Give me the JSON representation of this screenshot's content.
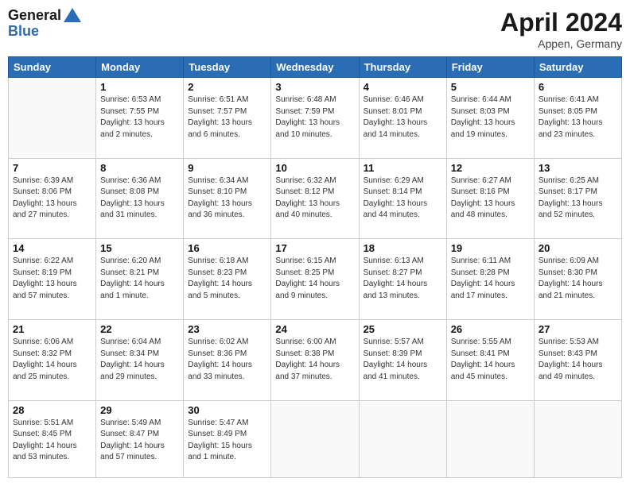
{
  "logo": {
    "line1": "General",
    "line2": "Blue"
  },
  "header": {
    "title": "April 2024",
    "subtitle": "Appen, Germany"
  },
  "days_of_week": [
    "Sunday",
    "Monday",
    "Tuesday",
    "Wednesday",
    "Thursday",
    "Friday",
    "Saturday"
  ],
  "weeks": [
    [
      {
        "day": "",
        "info": ""
      },
      {
        "day": "1",
        "info": "Sunrise: 6:53 AM\nSunset: 7:55 PM\nDaylight: 13 hours\nand 2 minutes."
      },
      {
        "day": "2",
        "info": "Sunrise: 6:51 AM\nSunset: 7:57 PM\nDaylight: 13 hours\nand 6 minutes."
      },
      {
        "day": "3",
        "info": "Sunrise: 6:48 AM\nSunset: 7:59 PM\nDaylight: 13 hours\nand 10 minutes."
      },
      {
        "day": "4",
        "info": "Sunrise: 6:46 AM\nSunset: 8:01 PM\nDaylight: 13 hours\nand 14 minutes."
      },
      {
        "day": "5",
        "info": "Sunrise: 6:44 AM\nSunset: 8:03 PM\nDaylight: 13 hours\nand 19 minutes."
      },
      {
        "day": "6",
        "info": "Sunrise: 6:41 AM\nSunset: 8:05 PM\nDaylight: 13 hours\nand 23 minutes."
      }
    ],
    [
      {
        "day": "7",
        "info": "Sunrise: 6:39 AM\nSunset: 8:06 PM\nDaylight: 13 hours\nand 27 minutes."
      },
      {
        "day": "8",
        "info": "Sunrise: 6:36 AM\nSunset: 8:08 PM\nDaylight: 13 hours\nand 31 minutes."
      },
      {
        "day": "9",
        "info": "Sunrise: 6:34 AM\nSunset: 8:10 PM\nDaylight: 13 hours\nand 36 minutes."
      },
      {
        "day": "10",
        "info": "Sunrise: 6:32 AM\nSunset: 8:12 PM\nDaylight: 13 hours\nand 40 minutes."
      },
      {
        "day": "11",
        "info": "Sunrise: 6:29 AM\nSunset: 8:14 PM\nDaylight: 13 hours\nand 44 minutes."
      },
      {
        "day": "12",
        "info": "Sunrise: 6:27 AM\nSunset: 8:16 PM\nDaylight: 13 hours\nand 48 minutes."
      },
      {
        "day": "13",
        "info": "Sunrise: 6:25 AM\nSunset: 8:17 PM\nDaylight: 13 hours\nand 52 minutes."
      }
    ],
    [
      {
        "day": "14",
        "info": "Sunrise: 6:22 AM\nSunset: 8:19 PM\nDaylight: 13 hours\nand 57 minutes."
      },
      {
        "day": "15",
        "info": "Sunrise: 6:20 AM\nSunset: 8:21 PM\nDaylight: 14 hours\nand 1 minute."
      },
      {
        "day": "16",
        "info": "Sunrise: 6:18 AM\nSunset: 8:23 PM\nDaylight: 14 hours\nand 5 minutes."
      },
      {
        "day": "17",
        "info": "Sunrise: 6:15 AM\nSunset: 8:25 PM\nDaylight: 14 hours\nand 9 minutes."
      },
      {
        "day": "18",
        "info": "Sunrise: 6:13 AM\nSunset: 8:27 PM\nDaylight: 14 hours\nand 13 minutes."
      },
      {
        "day": "19",
        "info": "Sunrise: 6:11 AM\nSunset: 8:28 PM\nDaylight: 14 hours\nand 17 minutes."
      },
      {
        "day": "20",
        "info": "Sunrise: 6:09 AM\nSunset: 8:30 PM\nDaylight: 14 hours\nand 21 minutes."
      }
    ],
    [
      {
        "day": "21",
        "info": "Sunrise: 6:06 AM\nSunset: 8:32 PM\nDaylight: 14 hours\nand 25 minutes."
      },
      {
        "day": "22",
        "info": "Sunrise: 6:04 AM\nSunset: 8:34 PM\nDaylight: 14 hours\nand 29 minutes."
      },
      {
        "day": "23",
        "info": "Sunrise: 6:02 AM\nSunset: 8:36 PM\nDaylight: 14 hours\nand 33 minutes."
      },
      {
        "day": "24",
        "info": "Sunrise: 6:00 AM\nSunset: 8:38 PM\nDaylight: 14 hours\nand 37 minutes."
      },
      {
        "day": "25",
        "info": "Sunrise: 5:57 AM\nSunset: 8:39 PM\nDaylight: 14 hours\nand 41 minutes."
      },
      {
        "day": "26",
        "info": "Sunrise: 5:55 AM\nSunset: 8:41 PM\nDaylight: 14 hours\nand 45 minutes."
      },
      {
        "day": "27",
        "info": "Sunrise: 5:53 AM\nSunset: 8:43 PM\nDaylight: 14 hours\nand 49 minutes."
      }
    ],
    [
      {
        "day": "28",
        "info": "Sunrise: 5:51 AM\nSunset: 8:45 PM\nDaylight: 14 hours\nand 53 minutes."
      },
      {
        "day": "29",
        "info": "Sunrise: 5:49 AM\nSunset: 8:47 PM\nDaylight: 14 hours\nand 57 minutes."
      },
      {
        "day": "30",
        "info": "Sunrise: 5:47 AM\nSunset: 8:49 PM\nDaylight: 15 hours\nand 1 minute."
      },
      {
        "day": "",
        "info": ""
      },
      {
        "day": "",
        "info": ""
      },
      {
        "day": "",
        "info": ""
      },
      {
        "day": "",
        "info": ""
      }
    ]
  ]
}
